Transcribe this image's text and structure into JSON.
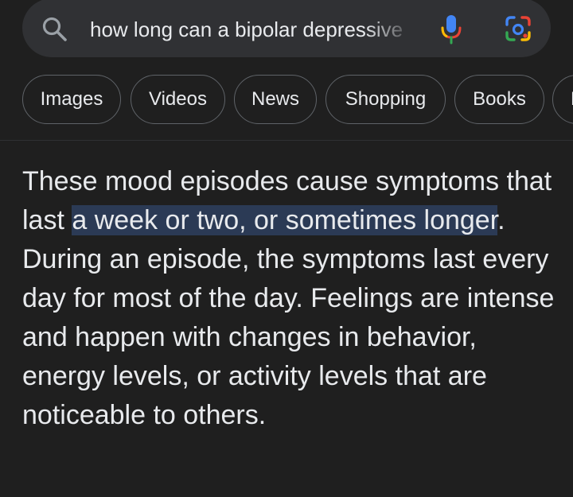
{
  "search": {
    "query": "how long can a bipolar depressive"
  },
  "icons": {
    "search": "search-icon",
    "mic": "mic-icon",
    "lens": "google-lens-icon"
  },
  "colors": {
    "background": "#1f1f1f",
    "search_bar": "#303134",
    "highlight": "#2b3a55",
    "text": "#e8eaed",
    "chip_border": "#5f6368"
  },
  "chips": [
    {
      "label": "Images"
    },
    {
      "label": "Videos"
    },
    {
      "label": "News"
    },
    {
      "label": "Shopping"
    },
    {
      "label": "Books"
    },
    {
      "label": "M"
    }
  ],
  "answer": {
    "before_highlight": "These mood episodes cause symptoms that last ",
    "highlight": "a week or two, or sometimes longer",
    "after_highlight": ". During an episode, the symptoms last every day for most of the day. Feelings are intense and happen with changes in behavior, energy levels, or activity levels that are noticeable to others."
  }
}
